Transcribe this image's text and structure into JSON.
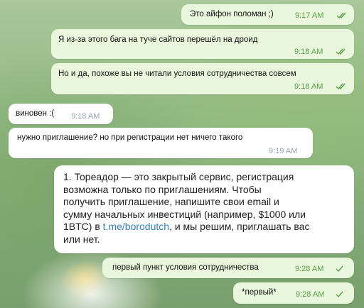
{
  "messages": [
    {
      "text": "Это айфон поломан ;)",
      "time": "9:17 AM",
      "status": "read"
    },
    {
      "text": "Я из-за этого бага на туче сайтов перешёл на дроид",
      "time": "9:18 AM",
      "status": "read"
    },
    {
      "text": "Но и да, похоже вы не читали условия сотрудничества совсем",
      "time": "9:18 AM",
      "status": "read"
    },
    {
      "text": "виновен :(",
      "time": "9:18 AM"
    },
    {
      "text": "нужно приглашение? но при регистрации нет ничего такого",
      "time": "9:19 AM"
    },
    {
      "lines": [
        "1. Тореадор — это закрытый сервис, регистрация",
        "возможна только по приглашениям. Чтобы",
        "получить приглашение, напишите свои email и",
        "сумму начальных инвестиций (например, $1000 или"
      ],
      "line5_before": "1BTC) в ",
      "line5_link": "t.me/borodutch",
      "line5_after": ", и мы решим, приглашать вас",
      "line6": "или нет."
    },
    {
      "text": "первый пункт условия сотрудничества",
      "time": "9:28 AM",
      "status": "sent"
    },
    {
      "text": "*первый*",
      "time": "9:28 AM",
      "status": "sent"
    }
  ],
  "colors": {
    "outgoing_bubble": "#e9f7dd",
    "incoming_bubble": "#ffffff",
    "check": "#5aa04a",
    "link": "#2f7fc1"
  },
  "icons": {
    "read": "double-check-icon",
    "sent": "single-check-icon"
  }
}
